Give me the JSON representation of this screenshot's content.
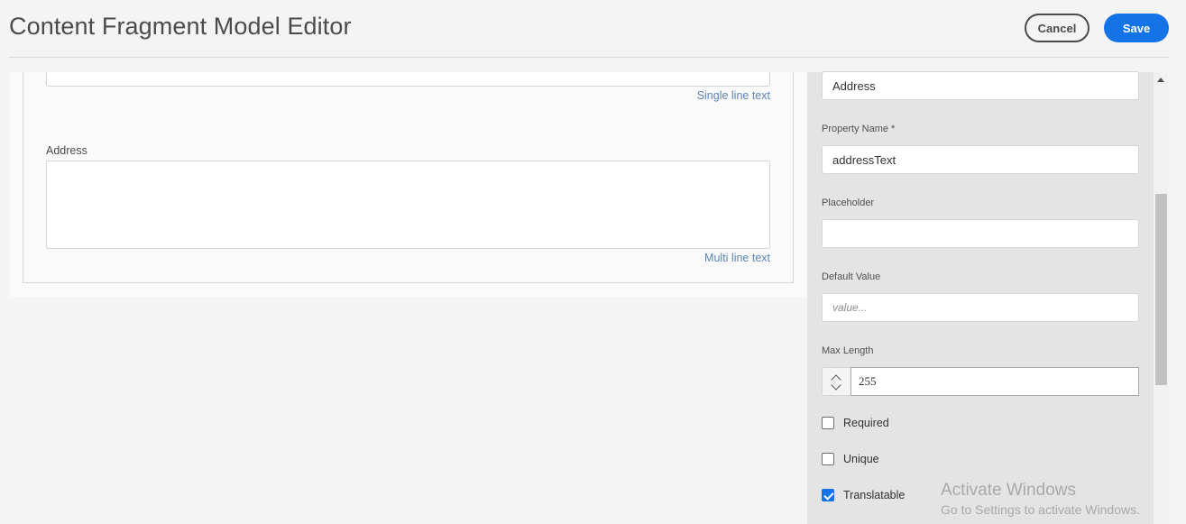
{
  "header": {
    "title": "Content Fragment Model Editor",
    "cancel_label": "Cancel",
    "save_label": "Save"
  },
  "canvas": {
    "fields": [
      {
        "label": "",
        "type_label": "Single line text"
      },
      {
        "label": "Address",
        "type_label": "Multi line text"
      }
    ]
  },
  "properties": {
    "field_label_value": "Address",
    "property_name": {
      "label": "Property Name *",
      "value": "addressText"
    },
    "placeholder": {
      "label": "Placeholder",
      "value": ""
    },
    "default_value": {
      "label": "Default Value",
      "placeholder": "value..."
    },
    "max_length": {
      "label": "Max Length",
      "value": "255"
    },
    "checkboxes": [
      {
        "label": "Required",
        "checked": false
      },
      {
        "label": "Unique",
        "checked": false
      },
      {
        "label": "Translatable",
        "checked": true
      }
    ]
  },
  "watermark": {
    "line1": "Activate Windows",
    "line2": "Go to Settings to activate Windows."
  },
  "colors": {
    "accent": "#1473e6",
    "type_label": "#5b84b8",
    "panel_bg": "#e4e4e4"
  }
}
